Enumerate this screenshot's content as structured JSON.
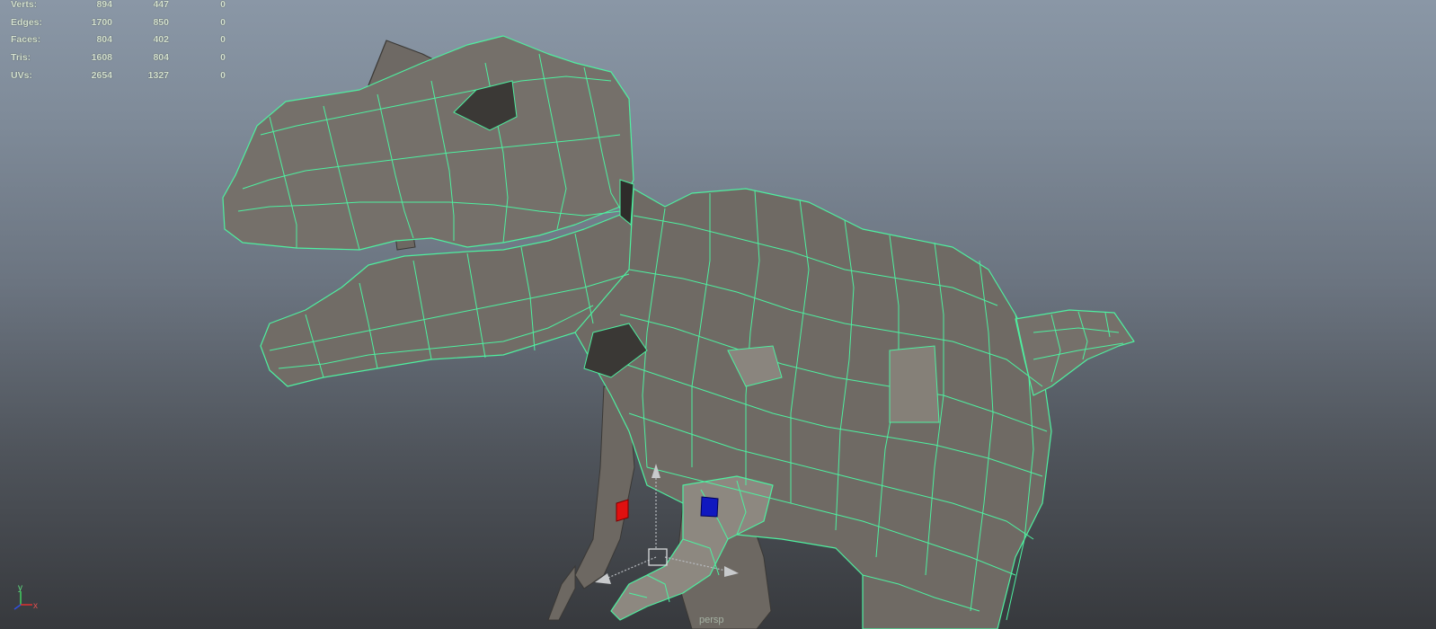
{
  "poly_stats": {
    "rows": [
      {
        "label": "Verts:",
        "values": [
          "894",
          "447",
          "0"
        ]
      },
      {
        "label": "Edges:",
        "values": [
          "1700",
          "850",
          "0"
        ]
      },
      {
        "label": "Faces:",
        "values": [
          "804",
          "402",
          "0"
        ]
      },
      {
        "label": "Tris:",
        "values": [
          "1608",
          "804",
          "0"
        ]
      },
      {
        "label": "UVs:",
        "values": [
          "2654",
          "1327",
          "0"
        ]
      }
    ]
  },
  "axis_gizmo": {
    "y_label": "y",
    "x_label": "x"
  },
  "camera_label": "persp",
  "colors": {
    "wireframe": "#4ef0a0",
    "mesh_fill": "#6b6660",
    "mesh_dark": "#3e3b38",
    "mesh_light": "#8a857e",
    "manip_x": "#e01010",
    "manip_z": "#1018c0"
  }
}
